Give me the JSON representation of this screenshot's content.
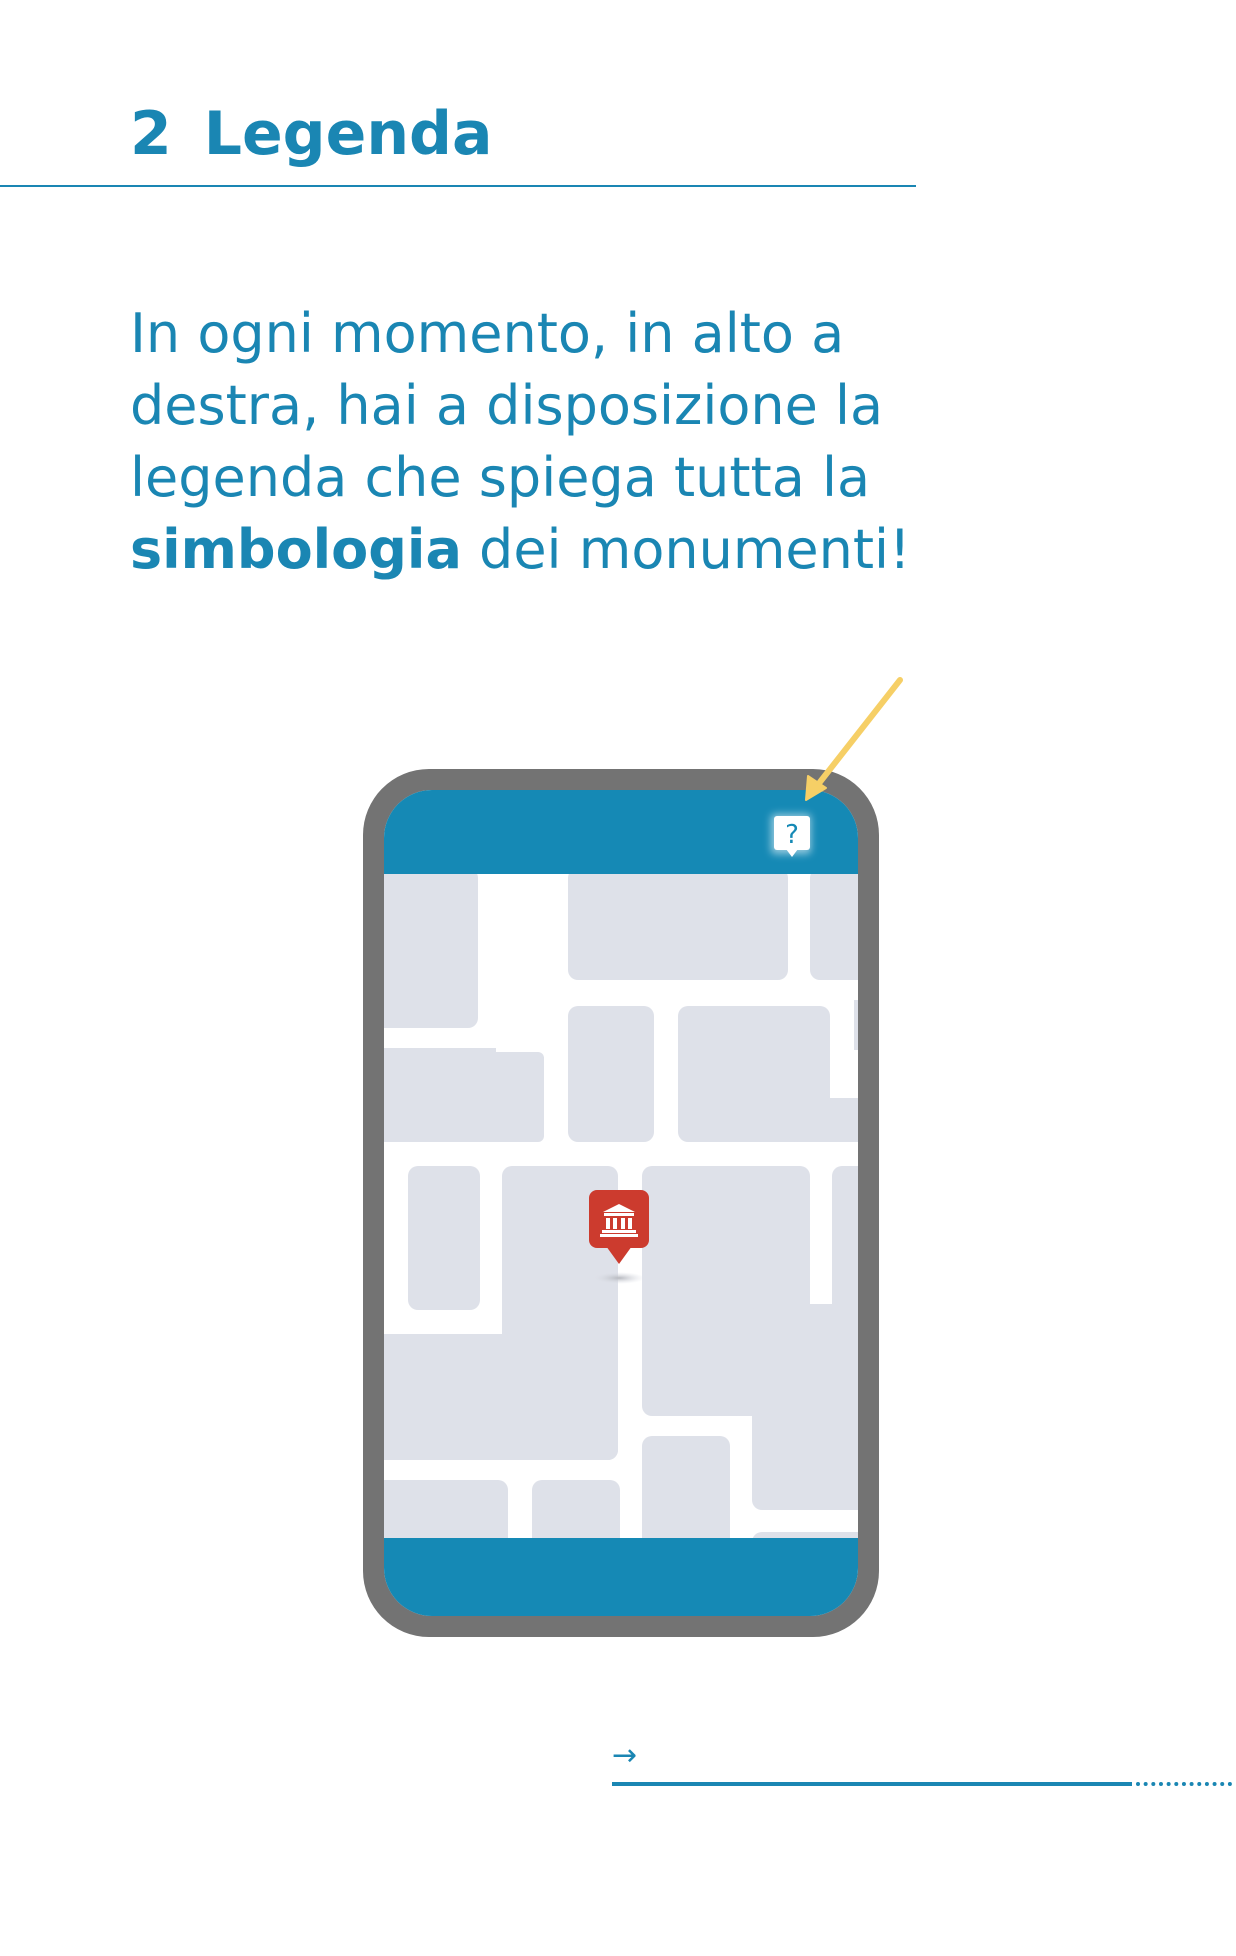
{
  "section": {
    "number": "2",
    "title": "Legenda"
  },
  "intro": {
    "line1": "In ogni momento, in alto a",
    "line2": "destra, hai a disposizione la",
    "line3": "legenda che spiega tutta la",
    "line4_bold": "simbologia",
    "line4_rest": " dei monumenti!"
  },
  "illustration": {
    "help_icon_glyph": "?",
    "help_icon": "question-mark-speech-bubble-icon",
    "marker_icon": "museum-building-icon",
    "pointer": "yellow-arrow",
    "colors": {
      "phone_frame": "#737373",
      "app_bar": "#1589b5",
      "map_block": "#dee1e9",
      "map_street": "#ffffff",
      "marker": "#cc3b2e",
      "pointer_arrow": "#f6cf66"
    }
  },
  "footer": {
    "next_arrow": "→"
  },
  "colors": {
    "accent": "#1a86b3",
    "background": "#ffffff"
  }
}
